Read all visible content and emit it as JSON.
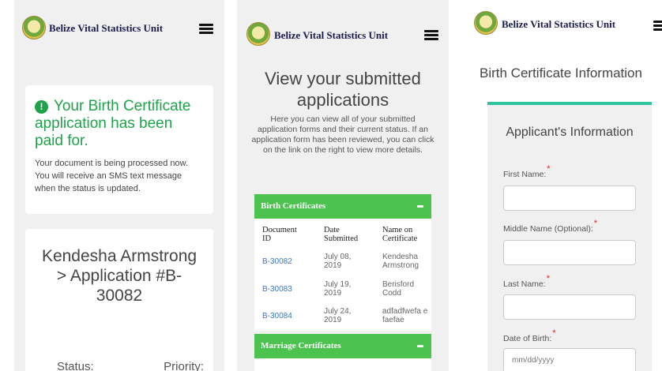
{
  "brand": "Belize Vital Statistics Unit",
  "panel1": {
    "paid_title": "Your Birth Certificate application has been paid for.",
    "paid_body": "Your document is being processed now. You will receive an SMS text message when the status is updated.",
    "app_name": "Kendesha Armstrong > Application #B-30082",
    "status_label": "Status:",
    "priority_label": "Priority:"
  },
  "panel2": {
    "heading": "View your submitted applications",
    "intro": "Here you can view all of your submitted application forms and their current status. If an application form has been reviewed, you can click on the link on the right to view more details.",
    "birth_section": "Birth Certificates",
    "marriage_section": "Marriage Certificates",
    "columns": [
      "Document ID",
      "Date Submitted",
      "Name on Certificate"
    ],
    "rows": [
      {
        "doc": "B-30082",
        "date": "July 08, 2019",
        "name": "Kendesha Armstrong"
      },
      {
        "doc": "B-30083",
        "date": "July 19, 2019",
        "name": "Berisford Codd"
      },
      {
        "doc": "B-30084",
        "date": "July 24, 2019",
        "name": "adfadfwefa efaefae"
      }
    ]
  },
  "panel3": {
    "title": "Birth Certificate Information",
    "form_title": "Applicant's Information",
    "fields": [
      {
        "label": "First Name:",
        "value": ""
      },
      {
        "label": "Middle Name (Optional):",
        "value": ""
      },
      {
        "label": "Last Name:",
        "value": ""
      },
      {
        "label": "Date of Birth:",
        "placeholder": "mm/dd/yyyy"
      }
    ],
    "required_mark": "*"
  },
  "colors": {
    "green": "#1ea34a",
    "section_green": "#4cc34f",
    "teal": "#2fc49b",
    "link": "#3a78c2"
  },
  "icons": [
    "logo-seal",
    "hamburger-menu-icon",
    "exclamation-circle-icon",
    "collapse-minus-icon"
  ]
}
